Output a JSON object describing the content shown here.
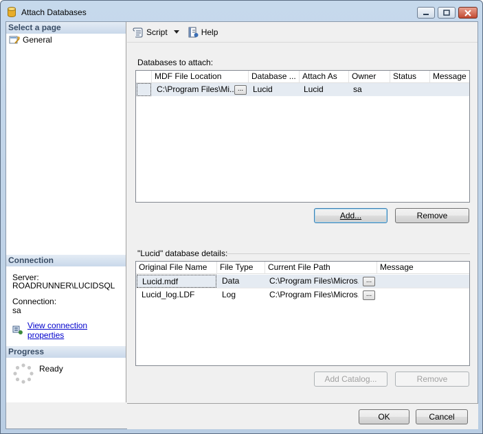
{
  "window": {
    "title": "Attach Databases"
  },
  "left": {
    "select_page": "Select a page",
    "pages": [
      {
        "label": "General"
      }
    ],
    "connection_header": "Connection",
    "server_label": "Server:",
    "server_value": "ROADRUNNER\\LUCIDSQL",
    "connection_label": "Connection:",
    "connection_value": "sa",
    "view_link": "View connection properties",
    "progress_header": "Progress",
    "progress_status": "Ready"
  },
  "toolbar": {
    "script": "Script",
    "help": "Help"
  },
  "attach": {
    "label": "Databases to attach:",
    "columns": [
      "MDF File Location",
      "Database ...",
      "Attach As",
      "Owner",
      "Status",
      "Message"
    ],
    "rows": [
      {
        "mdf": "C:\\Program Files\\Mi...",
        "database": "Lucid",
        "attach_as": "Lucid",
        "owner": "sa",
        "status": "",
        "message": ""
      }
    ],
    "add": "Add...",
    "remove": "Remove"
  },
  "details": {
    "label": "\"Lucid\" database details:",
    "columns": [
      "Original File Name",
      "File Type",
      "Current File Path",
      "Message"
    ],
    "rows": [
      {
        "name": "Lucid.mdf",
        "type": "Data",
        "path": "C:\\Program Files\\Micros...",
        "message": ""
      },
      {
        "name": "Lucid_log.LDF",
        "type": "Log",
        "path": "C:\\Program Files\\Micros...",
        "message": ""
      }
    ],
    "add_catalog": "Add Catalog...",
    "remove": "Remove"
  },
  "footer": {
    "ok": "OK",
    "cancel": "Cancel"
  },
  "ellipsis": "..."
}
